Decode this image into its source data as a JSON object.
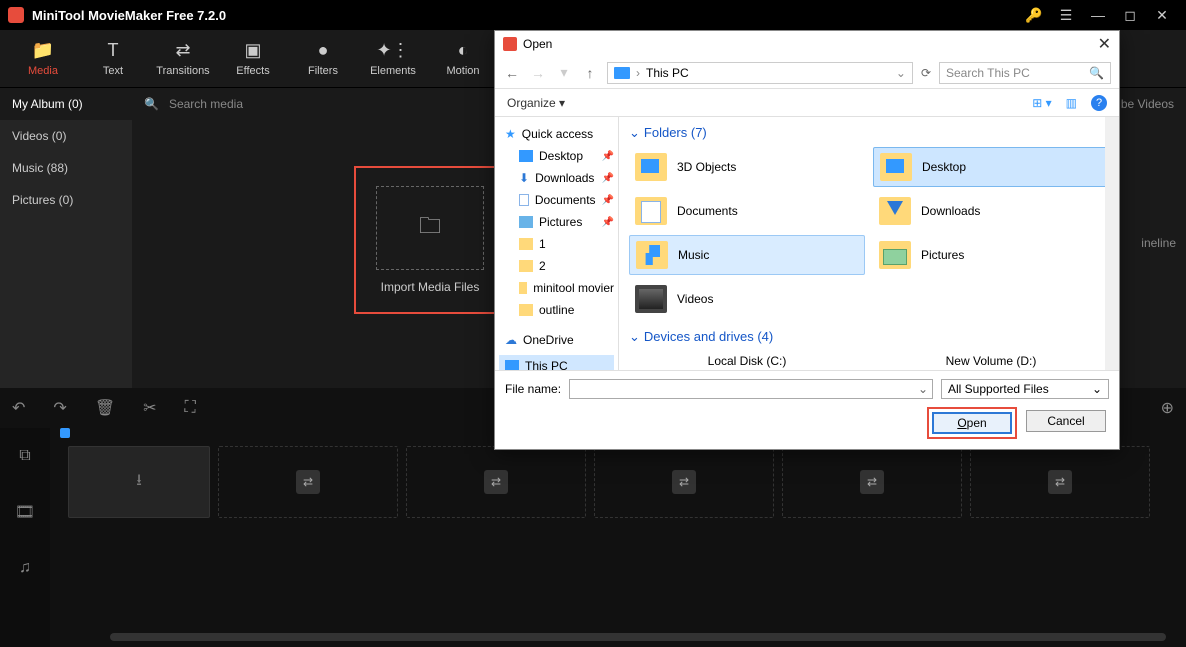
{
  "titlebar": {
    "title": "MiniTool MovieMaker Free 7.2.0"
  },
  "toolbar": {
    "media": "Media",
    "text": "Text",
    "transitions": "Transitions",
    "effects": "Effects",
    "filters": "Filters",
    "elements": "Elements",
    "motion": "Motion"
  },
  "sidebar": {
    "tabs": [
      "My Album (0)",
      "Videos (0)",
      "Music (88)",
      "Pictures (0)"
    ]
  },
  "mediapane": {
    "search": "Search media",
    "download": "Download YouTube Videos",
    "import": "Import Media Files"
  },
  "dialog": {
    "title": "Open",
    "address": "This PC",
    "search_placeholder": "Search This PC",
    "organize": "Organize",
    "tree": {
      "quick": "Quick access",
      "desktop": "Desktop",
      "downloads": "Downloads",
      "documents": "Documents",
      "pictures": "Pictures",
      "n1": "1",
      "n2": "2",
      "minitool": "minitool movier",
      "outline": "outline",
      "onedrive": "OneDrive",
      "thispc": "This PC"
    },
    "folders_header": "Folders (7)",
    "folders": {
      "objects3d": "3D Objects",
      "desktop": "Desktop",
      "documents": "Documents",
      "downloads": "Downloads",
      "music": "Music",
      "pictures": "Pictures",
      "videos": "Videos"
    },
    "devices_header": "Devices and drives (4)",
    "devices": {
      "local": "Local Disk (C:)",
      "newvol": "New Volume (D:)"
    },
    "filename_label": "File name:",
    "filetype": "All Supported Files",
    "open_btn": "Open",
    "cancel_btn": "Cancel"
  },
  "background_hint": "ineline"
}
